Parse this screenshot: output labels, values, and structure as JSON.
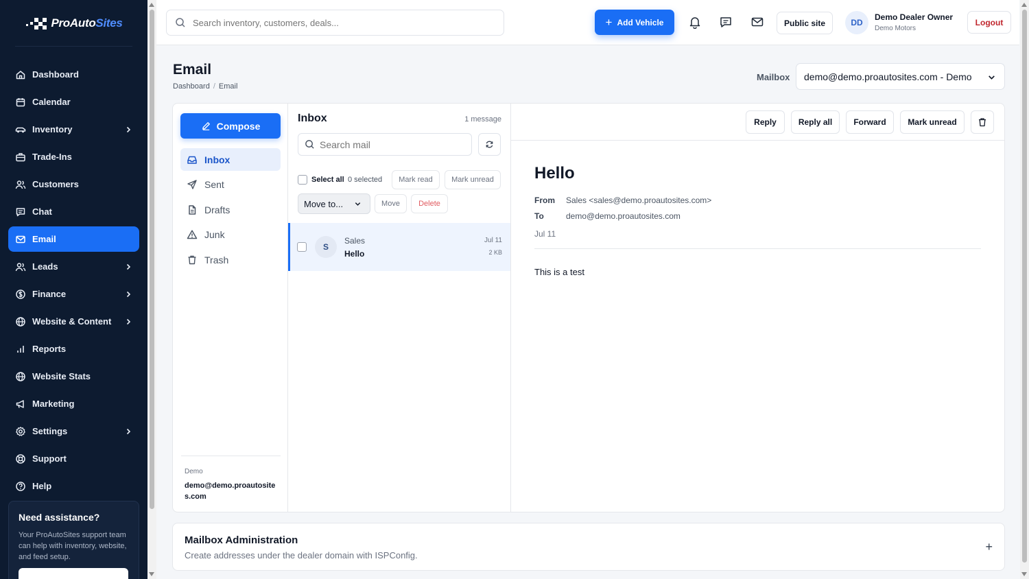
{
  "brand": {
    "name_main": "ProAuto",
    "name_accent": "Sites"
  },
  "sidebar": {
    "items": [
      {
        "label": "Dashboard",
        "icon": "home-icon",
        "chevron": false,
        "active": false
      },
      {
        "label": "Calendar",
        "icon": "calendar-icon",
        "chevron": false,
        "active": false
      },
      {
        "label": "Inventory",
        "icon": "car-icon",
        "chevron": true,
        "active": false
      },
      {
        "label": "Trade-Ins",
        "icon": "briefcase-icon",
        "chevron": false,
        "active": false
      },
      {
        "label": "Customers",
        "icon": "users-icon",
        "chevron": false,
        "active": false
      },
      {
        "label": "Chat",
        "icon": "chat-icon",
        "chevron": false,
        "active": false
      },
      {
        "label": "Email",
        "icon": "mail-icon",
        "chevron": false,
        "active": true
      },
      {
        "label": "Leads",
        "icon": "users-icon",
        "chevron": true,
        "active": false
      },
      {
        "label": "Finance",
        "icon": "dollar-icon",
        "chevron": true,
        "active": false
      },
      {
        "label": "Website & Content",
        "icon": "globe-icon",
        "chevron": true,
        "active": false
      },
      {
        "label": "Reports",
        "icon": "bar-chart-icon",
        "chevron": false,
        "active": false
      },
      {
        "label": "Website Stats",
        "icon": "globe-icon",
        "chevron": false,
        "active": false
      },
      {
        "label": "Marketing",
        "icon": "megaphone-icon",
        "chevron": false,
        "active": false
      },
      {
        "label": "Settings",
        "icon": "gear-icon",
        "chevron": true,
        "active": false
      },
      {
        "label": "Support",
        "icon": "lifebuoy-icon",
        "chevron": false,
        "active": false
      },
      {
        "label": "Help",
        "icon": "help-circle-icon",
        "chevron": false,
        "active": false
      }
    ],
    "assist": {
      "title": "Need assistance?",
      "text": "Your ProAutoSites support team can help with inventory, website, and feed setup."
    }
  },
  "topbar": {
    "search_placeholder": "Search inventory, customers, deals...",
    "add_vehicle": "Add Vehicle",
    "public_site": "Public site",
    "avatar_initials": "DD",
    "user_name": "Demo Dealer Owner",
    "dealer": "Demo Motors",
    "logout": "Logout"
  },
  "page": {
    "title": "Email",
    "breadcrumb": [
      "Dashboard",
      "Email"
    ],
    "mailbox_label": "Mailbox",
    "mailbox_value": "demo@demo.proautosites.com - Demo"
  },
  "folders": {
    "compose": "Compose",
    "items": [
      {
        "label": "Inbox",
        "icon": "inbox-icon",
        "active": true
      },
      {
        "label": "Sent",
        "icon": "send-icon",
        "active": false
      },
      {
        "label": "Drafts",
        "icon": "file-icon",
        "active": false
      },
      {
        "label": "Junk",
        "icon": "warning-icon",
        "active": false
      },
      {
        "label": "Trash",
        "icon": "trash-icon",
        "active": false
      }
    ],
    "account_name": "Demo",
    "account_email": "demo@demo.proautosites.com"
  },
  "list": {
    "title": "Inbox",
    "count": "1 message",
    "search_placeholder": "Search mail",
    "select_all": "Select all",
    "selected": "0 selected",
    "mark_read": "Mark read",
    "mark_unread": "Mark unread",
    "move_to": "Move to...",
    "move": "Move",
    "delete": "Delete",
    "messages": [
      {
        "initial": "S",
        "from": "Sales",
        "subject": "Hello",
        "date": "Jul 11",
        "size": "2 KB"
      }
    ]
  },
  "reader": {
    "reply": "Reply",
    "reply_all": "Reply all",
    "forward": "Forward",
    "mark_unread": "Mark unread",
    "subject": "Hello",
    "from_label": "From",
    "from_value": "Sales <sales@demo.proautosites.com>",
    "to_label": "To",
    "to_value": "demo@demo.proautosites.com",
    "date": "Jul 11",
    "body": "This is a test"
  },
  "admin": {
    "title": "Mailbox Administration",
    "desc": "Create addresses under the dealer domain with ISPConfig.",
    "toggle": "+"
  },
  "colors": {
    "accent": "#1a6ef5",
    "sidebar_bg": "#0d1b30",
    "danger": "#c0262d"
  }
}
